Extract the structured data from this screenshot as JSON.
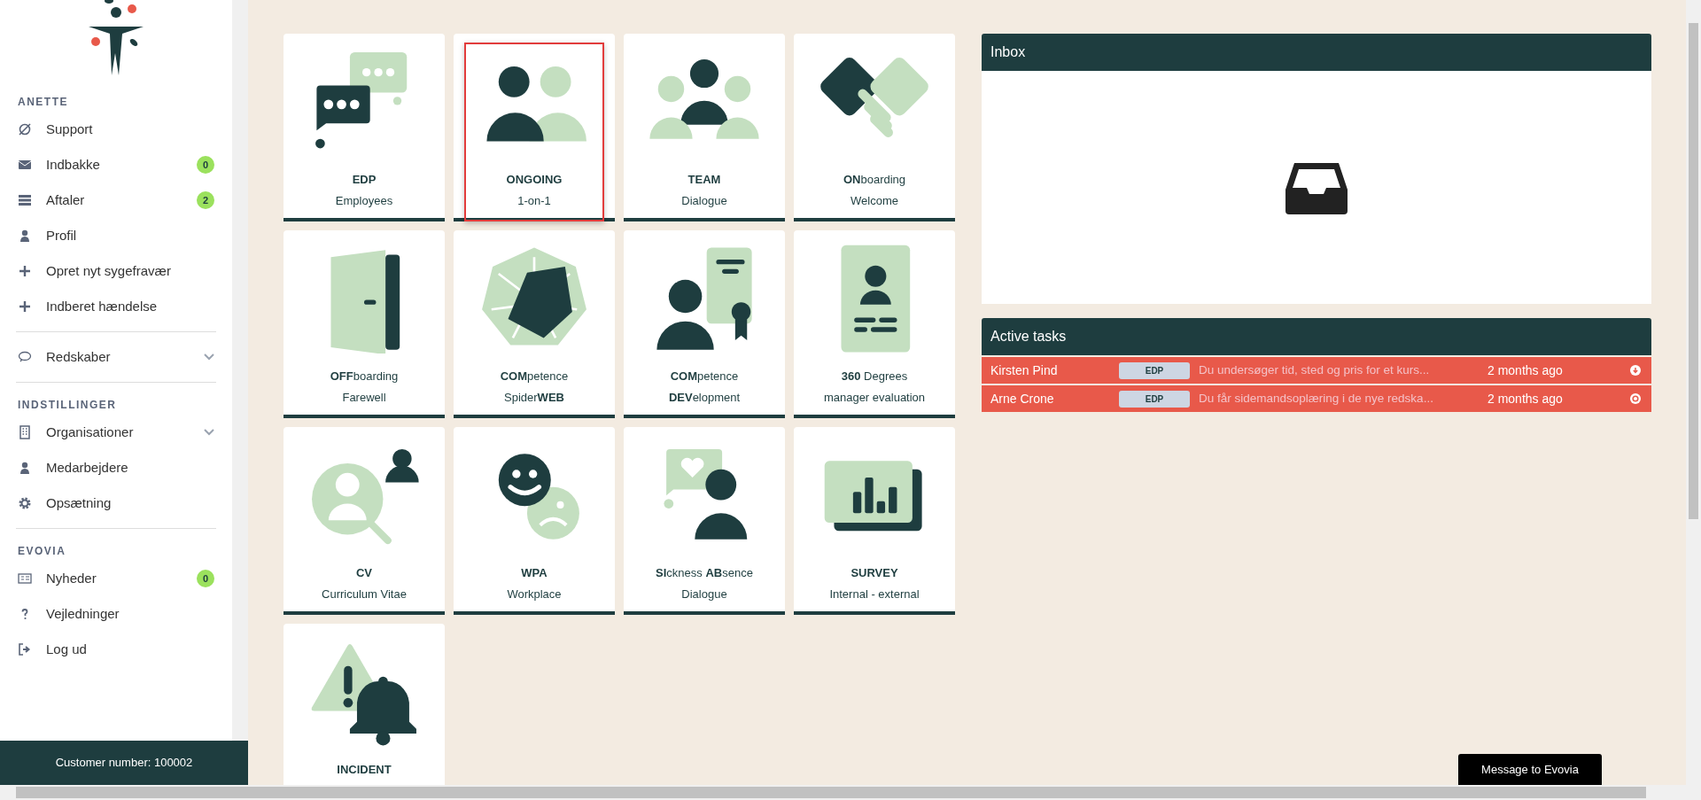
{
  "sidebar": {
    "sections": [
      {
        "heading": "ANETTE",
        "items": [
          {
            "label": "Support",
            "kind": "support"
          },
          {
            "label": "Indbakke",
            "kind": "mail",
            "badge": "0"
          },
          {
            "label": "Aftaler",
            "kind": "list",
            "badge": "2"
          },
          {
            "label": "Profil",
            "kind": "person"
          },
          {
            "label": "Opret nyt sygefravær",
            "kind": "plus"
          },
          {
            "label": "Indberet hændelse",
            "kind": "plus"
          }
        ]
      },
      {
        "items": [
          {
            "label": "Redskaber",
            "kind": "chat",
            "expanded": false
          }
        ]
      },
      {
        "heading": "INDSTILLINGER",
        "items": [
          {
            "label": "Organisationer",
            "kind": "building",
            "expanded": false
          },
          {
            "label": "Medarbejdere",
            "kind": "person"
          },
          {
            "label": "Opsætning",
            "kind": "gear"
          }
        ]
      },
      {
        "heading": "EVOVIA",
        "items": [
          {
            "label": "Nyheder",
            "kind": "news",
            "badge": "0"
          },
          {
            "label": "Vejledninger",
            "kind": "question"
          },
          {
            "label": "Log ud",
            "kind": "logout"
          }
        ]
      }
    ],
    "footer": "Customer number: 100002"
  },
  "tiles": [
    {
      "kind": "chat",
      "title": "EDP",
      "bold": true,
      "subtitle": "Employees",
      "selected": false
    },
    {
      "kind": "pair",
      "title": "ONGOING",
      "bold": true,
      "subtitle": "1-on-1",
      "selected": true
    },
    {
      "kind": "team",
      "title": "TEAM",
      "bold": true,
      "subtitle": "Dialogue",
      "selected": false
    },
    {
      "kind": "handshake",
      "title": "**ON**boarding",
      "bold": false,
      "subtitle": "Welcome",
      "selected": false
    },
    {
      "kind": "door",
      "title": "**OFF**boarding",
      "bold": false,
      "subtitle": "Farewell",
      "selected": false
    },
    {
      "kind": "spider",
      "title": "**COM**petence",
      "bold": false,
      "subtitle": "Spider**WEB**",
      "selected": false
    },
    {
      "kind": "certificate",
      "title": "**COM**petence",
      "bold": false,
      "subtitle": "**DEV**elopment",
      "selected": false
    },
    {
      "kind": "idcard",
      "title": "**360** Degrees",
      "bold": false,
      "subtitle": "manager evaluation",
      "selected": false
    },
    {
      "kind": "cv",
      "title": "CV",
      "bold": true,
      "subtitle": "Curriculum Vitae",
      "selected": false
    },
    {
      "kind": "smileys",
      "title": "WPA",
      "bold": true,
      "subtitle": "Workplace",
      "selected": false
    },
    {
      "kind": "sick",
      "title": "**SI**ckness **AB**sence",
      "bold": false,
      "subtitle": "Dialogue",
      "selected": false
    },
    {
      "kind": "survey",
      "title": "SURVEY",
      "bold": true,
      "subtitle": "Internal - external",
      "selected": false
    },
    {
      "kind": "incident",
      "title": "INCIDENT",
      "bold": true,
      "selected": false
    }
  ],
  "inbox": {
    "title": "Inbox"
  },
  "active_tasks": {
    "title": "Active tasks",
    "rows": [
      {
        "name": "Kirsten Pind",
        "tag": "EDP",
        "description": "Du undersøger tid, sted og pris for et kurs...",
        "time": "2 months ago",
        "kind": "arrow"
      },
      {
        "name": "Arne Crone",
        "tag": "EDP",
        "description": "Du får sidemandsoplæring i de nye redska...",
        "time": "2 months ago",
        "kind": "dot"
      }
    ]
  },
  "message_button": "Message to Evovia"
}
